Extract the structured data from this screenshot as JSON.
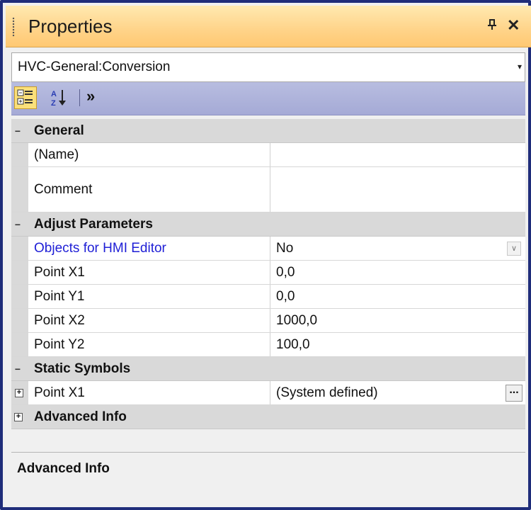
{
  "window": {
    "title": "Properties",
    "pin_glyph": "Ԅ",
    "close_glyph": "✕"
  },
  "selector": {
    "value": "HVC-General:Conversion",
    "arrow": "▾"
  },
  "toolbar": {
    "categorized_icon": "categorized-icon",
    "alphabetical_icon": "sort-alpha-icon",
    "more_glyph": "»"
  },
  "grid": {
    "categories": [
      {
        "name": "General",
        "toggle": "−",
        "properties": [
          {
            "name": "(Name)",
            "value": ""
          },
          {
            "name": "Comment",
            "value": ""
          }
        ]
      },
      {
        "name": "Adjust Parameters",
        "toggle": "−",
        "properties": [
          {
            "name": "Objects for HMI Editor",
            "value": "No"
          },
          {
            "name": "Point X1",
            "value": "0,0"
          },
          {
            "name": "Point Y1",
            "value": "0,0"
          },
          {
            "name": "Point X2",
            "value": "1000,0"
          },
          {
            "name": "Point Y2",
            "value": "100,0"
          }
        ]
      },
      {
        "name": "Static Symbols",
        "toggle": "−",
        "properties": [
          {
            "name": "Point X1",
            "value": "(System defined)",
            "expand": "+",
            "button": "..."
          }
        ]
      },
      {
        "name": "Advanced Info",
        "toggle": "+",
        "properties": []
      }
    ]
  },
  "description": {
    "title": "Advanced Info"
  },
  "colors": {
    "title_bar": "#ffd58c",
    "toolbar": "#b8bde0",
    "frame_border": "#1f2d7a",
    "link_text": "#1f1fd6"
  }
}
